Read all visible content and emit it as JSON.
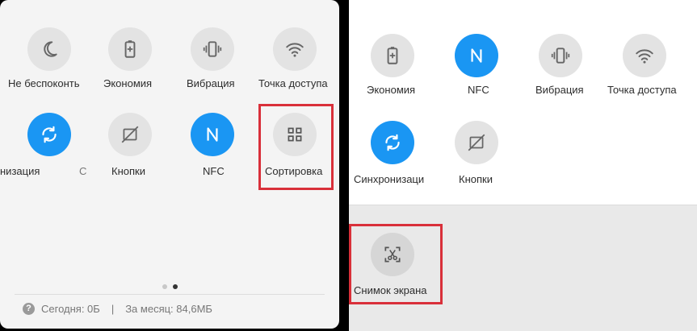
{
  "colors": {
    "accent": "#1a96f3",
    "highlight": "#d9303a",
    "tile_bg": "#e3e3e3"
  },
  "left": {
    "row1": [
      {
        "label": "Не беспоконть",
        "icon": "moon-icon"
      },
      {
        "label": "Экономия",
        "icon": "battery-icon"
      },
      {
        "label": "Вибрация",
        "icon": "vibration-icon"
      },
      {
        "label": "Точка доступа",
        "icon": "hotspot-icon"
      }
    ],
    "row2": [
      {
        "label": "низация",
        "icon": "sync-icon"
      },
      {
        "label": "С",
        "icon": ""
      },
      {
        "label": "Кнопки",
        "icon": "buttons-icon"
      },
      {
        "label": "NFC",
        "icon": "nfc-icon"
      },
      {
        "label": "Сортировка",
        "icon": "grid-icon"
      }
    ],
    "footer": {
      "help": "?",
      "today": "Сегодня: 0Б",
      "separator": "|",
      "month": "За месяц: 84,6МБ"
    }
  },
  "right": {
    "row1": [
      {
        "label": "Экономия",
        "icon": "battery-icon"
      },
      {
        "label": "NFC",
        "icon": "nfc-icon"
      },
      {
        "label": "Вибрация",
        "icon": "vibration-icon"
      },
      {
        "label": "Точка доступа",
        "icon": "hotspot-icon"
      }
    ],
    "row2": [
      {
        "label": "Синхронизаци",
        "icon": "sync-icon"
      },
      {
        "label": "Кнопки",
        "icon": "buttons-icon"
      }
    ],
    "extra": {
      "label": "Снимок экрана",
      "icon": "screenshot-icon"
    }
  }
}
